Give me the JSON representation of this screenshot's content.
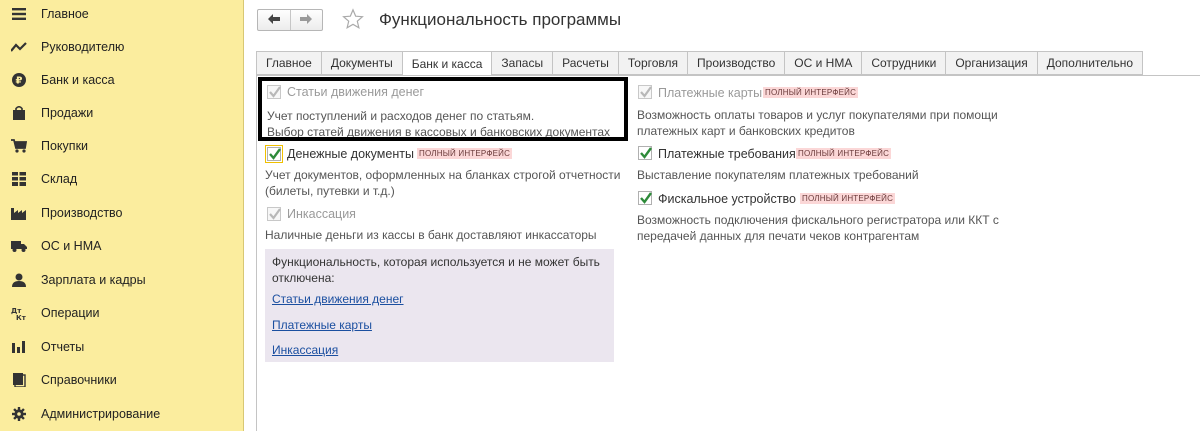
{
  "sidebar": {
    "items": [
      {
        "label": "Главное",
        "icon": "menu-icon"
      },
      {
        "label": "Руководителю",
        "icon": "trend-icon"
      },
      {
        "label": "Банк и касса",
        "icon": "ruble-icon"
      },
      {
        "label": "Продажи",
        "icon": "bag-icon"
      },
      {
        "label": "Покупки",
        "icon": "cart-icon"
      },
      {
        "label": "Склад",
        "icon": "warehouse-icon"
      },
      {
        "label": "Производство",
        "icon": "factory-icon"
      },
      {
        "label": "ОС и НМА",
        "icon": "truck-icon"
      },
      {
        "label": "Зарплата и кадры",
        "icon": "person-icon"
      },
      {
        "label": "Операции",
        "icon": "operations-icon"
      },
      {
        "label": "Отчеты",
        "icon": "bar-chart-icon"
      },
      {
        "label": "Справочники",
        "icon": "books-icon"
      },
      {
        "label": "Администрирование",
        "icon": "gear-icon"
      }
    ]
  },
  "header": {
    "back_icon": "arrow-left-icon",
    "forward_icon": "arrow-right-icon",
    "title": "Функциональность программы"
  },
  "tabs": [
    {
      "label": "Главное",
      "active": false
    },
    {
      "label": "Документы",
      "active": false
    },
    {
      "label": "Банк и касса",
      "active": true
    },
    {
      "label": "Запасы",
      "active": false
    },
    {
      "label": "Расчеты",
      "active": false
    },
    {
      "label": "Торговля",
      "active": false
    },
    {
      "label": "Производство",
      "active": false
    },
    {
      "label": "ОС и НМА",
      "active": false
    },
    {
      "label": "Сотрудники",
      "active": false
    },
    {
      "label": "Организация",
      "active": false
    },
    {
      "label": "Дополнительно",
      "active": false
    }
  ],
  "options": {
    "cashflow_items": {
      "label": "Статьи движения денег",
      "checked": true,
      "enabled": false,
      "description": "Учет поступлений и расходов денег по статьям.\nВыбор статей движения в кассовых и банковских документах"
    },
    "money_docs": {
      "label": "Денежные документы",
      "checked": true,
      "enabled": true,
      "badge": "ПОЛНЫЙ ИНТЕРФЕЙС",
      "description": "Учет документов, оформленных на бланках строгой отчетности\n(билеты, путевки и т.д.)"
    },
    "collection": {
      "label": "Инкассация",
      "checked": true,
      "enabled": false,
      "description": "Наличные деньги из кассы в банк доставляют инкассаторы"
    },
    "payment_cards": {
      "label": "Платежные карты",
      "checked": true,
      "enabled": false,
      "badge": "ПОЛНЫЙ ИНТЕРФЕЙС",
      "description": "Возможность оплаты товаров и услуг покупателями при помощи\nплатежных карт и банковских кредитов"
    },
    "payment_requests": {
      "label": "Платежные требования",
      "checked": true,
      "enabled": true,
      "badge": "ПОЛНЫЙ ИНТЕРФЕЙС",
      "description": "Выставление покупателям платежных требований"
    },
    "fiscal_device": {
      "label": "Фискальное устройство",
      "checked": true,
      "enabled": true,
      "badge": "ПОЛНЫЙ ИНТЕРФЕЙС",
      "description": "Возможность подключения фискального регистратора или ККТ с\nпередачей данных для печати чеков контрагентам"
    }
  },
  "info_box": {
    "text": "Функциональность, которая используется и не может быть\nотключена:",
    "links": [
      "Статьи движения денег",
      "Платежные карты",
      "Инкассация"
    ]
  },
  "colors": {
    "sidebar_bg": "#fbed9e",
    "check_green": "#2e8b3a",
    "check_disabled": "#b8b8b8",
    "badge_bg": "#fbd7d7",
    "link": "#1b4fa0",
    "info_bg": "#ebe6ef"
  }
}
